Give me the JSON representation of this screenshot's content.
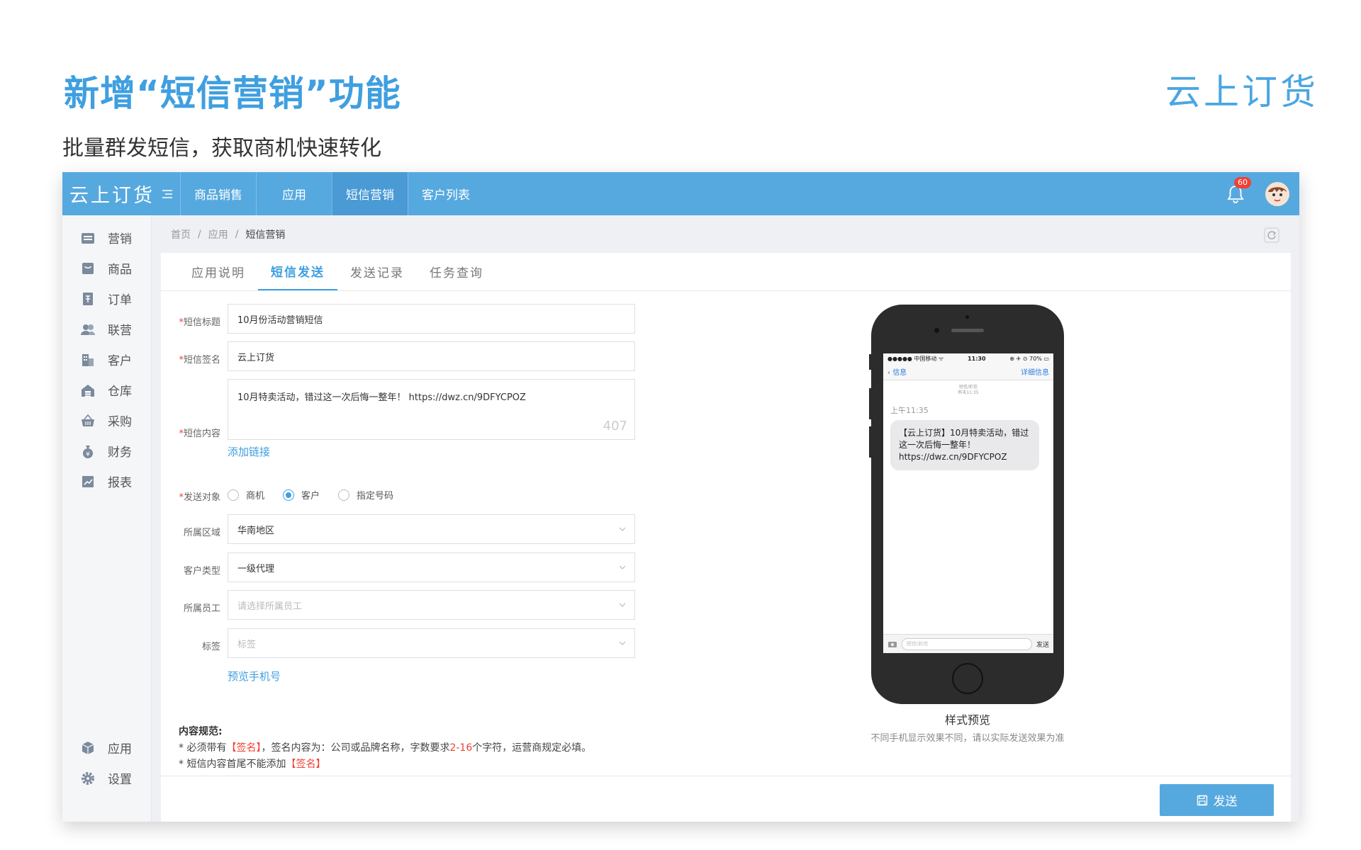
{
  "slide": {
    "title": "新增“短信营销”功能",
    "subtitle": "批量群发短信，获取商机快速转化",
    "logo": "云上订货"
  },
  "colors": {
    "accent": "#56a9df",
    "title": "#3f9fe0",
    "required": "#f04134"
  },
  "topbar": {
    "logo": "云上订货",
    "nav": [
      "商品销售",
      "应用",
      "短信营销",
      "客户列表"
    ],
    "active_nav": "短信营销",
    "notification_count": "60"
  },
  "sidebar": {
    "items": [
      {
        "label": "营销",
        "icon": "store-icon"
      },
      {
        "label": "商品",
        "icon": "bag-icon"
      },
      {
        "label": "订单",
        "icon": "order-icon"
      },
      {
        "label": "联营",
        "icon": "users-icon"
      },
      {
        "label": "客户",
        "icon": "building-icon"
      },
      {
        "label": "仓库",
        "icon": "warehouse-icon"
      },
      {
        "label": "采购",
        "icon": "basket-icon"
      },
      {
        "label": "财务",
        "icon": "money-bag-icon"
      },
      {
        "label": "报表",
        "icon": "chart-icon"
      }
    ],
    "bottom": [
      {
        "label": "应用",
        "icon": "cube-icon"
      },
      {
        "label": "设置",
        "icon": "gear-icon"
      }
    ]
  },
  "breadcrumb": [
    "首页",
    "应用",
    "短信营销"
  ],
  "tabs": [
    "应用说明",
    "短信发送",
    "发送记录",
    "任务查询"
  ],
  "active_tab": "短信发送",
  "form": {
    "title_label": "短信标题",
    "title_value": "10月份活动营销短信",
    "sign_label": "短信签名",
    "sign_value": "云上订货",
    "content_label": "短信内容",
    "content_value": "10月特卖活动，错过这一次后悔一整年！ https://dwz.cn/9DFYCPOZ",
    "content_counter": "407",
    "add_link": "添加链接",
    "target_label": "发送对象",
    "target_options": [
      "商机",
      "客户",
      "指定号码"
    ],
    "target_selected": "客户",
    "region_label": "所属区域",
    "region_value": "华南地区",
    "type_label": "客户类型",
    "type_value": "一级代理",
    "staff_label": "所属员工",
    "staff_placeholder": "请选择所属员工",
    "tag_label": "标签",
    "tag_placeholder": "标签",
    "preview_phone": "预览手机号"
  },
  "rules": {
    "heading": "内容规范:",
    "line1_a": "* 必须带有",
    "line1_sign": "【签名】",
    "line1_b": "，签名内容为：公司或品牌名称，字数要求",
    "line1_range": "2-16",
    "line1_c": "个字符，运营商规定必填。",
    "line2_a": "* 短信内容首尾不能添加",
    "line2_sign": "【签名】"
  },
  "footer": {
    "send_label": "发送"
  },
  "phone": {
    "carrier": "●●●●● 中国移动 ᯤ",
    "time": "11:30",
    "battery": "⊕ ✈ ⊙ 70% ▭",
    "back": "信息",
    "details": "详细信息",
    "meta1": "短信/彩信",
    "meta2": "昨天11:35",
    "msg_time": "上午11:35",
    "message": "【云上订货】10月特卖活动，错过这一次后悔一整年！ https://dwz.cn/9DFYCPOZ",
    "input_placeholder": "短信/彩信",
    "send": "发送"
  },
  "preview": {
    "caption": "样式预览",
    "note": "不同手机显示效果不同，请以实际发送效果为准"
  }
}
